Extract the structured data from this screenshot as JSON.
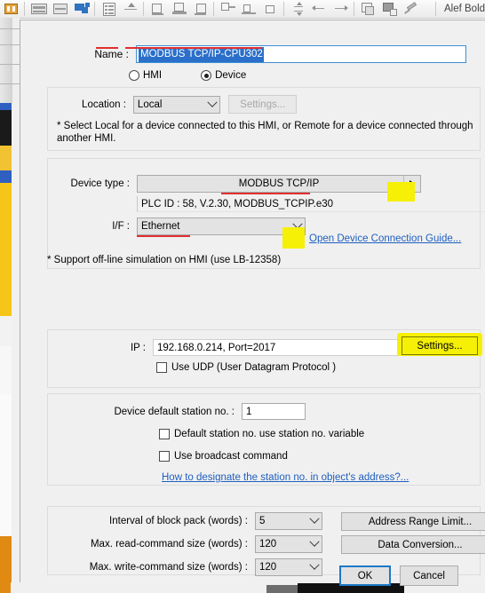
{
  "toolbar": {
    "font_name": "Alef Bold",
    "icons": [
      "project-icon",
      "horizontal-align-icon",
      "vertical-align-icon",
      "bring-front-icon",
      "list-icon",
      "up-icon",
      "align-left-icon",
      "align-center-icon",
      "align-right-icon",
      "align-top-icon",
      "align-middle-icon",
      "align-bottom-icon",
      "same-width-icon",
      "same-height-icon",
      "same-size-icon",
      "distribute-v-icon",
      "distribute-h-left-icon",
      "distribute-h-right-icon",
      "group-icon",
      "ungroup-icon",
      "pin-icon"
    ]
  },
  "dialog": {
    "name": {
      "label": "Name :",
      "value": "MODBUS TCP/IP-CPU302"
    },
    "kind": {
      "hmi_label": "HMI",
      "device_label": "Device",
      "selected": "Device"
    },
    "location": {
      "label": "Location :",
      "value": "Local",
      "settings_label": "Settings...",
      "note": "* Select Local for a device connected to this HMI, or Remote for a device connected through another HMI."
    },
    "device": {
      "type_label": "Device type :",
      "type_value": "MODBUS TCP/IP",
      "plc_info": "PLC ID : 58, V.2.30, MODBUS_TCPIP.e30",
      "if_label": "I/F :",
      "if_value": "Ethernet",
      "guide_link": "Open Device Connection Guide...",
      "sim_note": "* Support off-line simulation on HMI (use LB-12358)"
    },
    "ip": {
      "label": "IP :",
      "value": "192.168.0.214,  Port=2017",
      "settings_label": "Settings...",
      "udp_label": "Use UDP (User Datagram Protocol )",
      "udp_checked": false
    },
    "station": {
      "default_label": "Device default station no. :",
      "default_value": "1",
      "use_variable_label": "Default station no. use station no. variable",
      "use_variable_checked": false,
      "broadcast_label": "Use broadcast command",
      "broadcast_checked": false,
      "help_link": "How to designate the station no. in object's address?..."
    },
    "block": {
      "rows": [
        {
          "label": "Interval of block pack (words) :",
          "value": "5"
        },
        {
          "label": "Max. read-command size (words) :",
          "value": "120"
        },
        {
          "label": "Max. write-command size (words) :",
          "value": "120"
        }
      ],
      "address_range_label": "Address Range Limit...",
      "data_conversion_label": "Data Conversion..."
    },
    "footer": {
      "ok_label": "OK",
      "cancel_label": "Cancel"
    }
  },
  "colors": {
    "highlight": "#f5f006",
    "underline": "#e03030",
    "link": "#1f5fbf",
    "selection": "#2a6fc9",
    "focus_border": "#1c78c8"
  }
}
